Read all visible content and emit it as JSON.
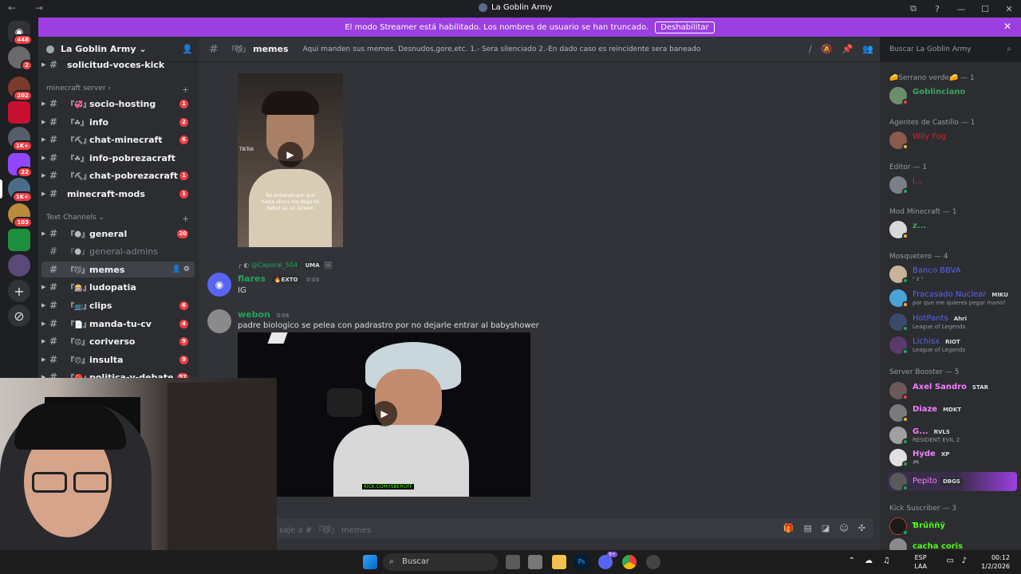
{
  "window": {
    "title": "La Goblin Army",
    "nav_arrows": "← →",
    "controls": [
      "⧉",
      "?",
      "—",
      "☐",
      "✕"
    ]
  },
  "banner": {
    "text": "El modo Streamer está habilitado. Los nombres de usuario se han truncado.",
    "button": "Deshabilitar",
    "close": "✕"
  },
  "rail": {
    "badges": [
      "448",
      "2",
      "202",
      "1K+",
      "22",
      "1K+",
      "103"
    ]
  },
  "guild": {
    "name": "La Goblin Army",
    "chevron": "⌄",
    "channels_top": [
      {
        "name": "solicitud-voces-kick",
        "emoji": "",
        "count": ""
      }
    ],
    "cat_minecraft": "minecraft server ›",
    "channels_mc": [
      {
        "name": "socio-hosting",
        "emoji": "『💞』",
        "count": "1"
      },
      {
        "name": "info",
        "emoji": "『☘』",
        "count": "2"
      },
      {
        "name": "chat-minecraft",
        "emoji": "『⛏』",
        "count": "6"
      },
      {
        "name": "info-pobrezacraft",
        "emoji": "『☘』",
        "count": ""
      },
      {
        "name": "chat-pobrezacraft",
        "emoji": "『⛏』",
        "count": "1"
      },
      {
        "name": "minecraft-mods",
        "emoji": "",
        "count": "1"
      }
    ],
    "cat_text": "Text Channels ⌄",
    "channels_text": [
      {
        "name": "general",
        "emoji": "『🌑』",
        "count": "20"
      },
      {
        "name": "general-admins",
        "emoji": "『🌑』",
        "count": ""
      },
      {
        "name": "memes",
        "emoji": "『😼』",
        "count": ""
      },
      {
        "name": "ludopatia",
        "emoji": "『🎰』",
        "count": ""
      },
      {
        "name": "clips",
        "emoji": "『📺』",
        "count": "6"
      },
      {
        "name": "manda-tu-cv",
        "emoji": "『📄』",
        "count": "4"
      },
      {
        "name": "coriverso",
        "emoji": "『😡』",
        "count": "9"
      },
      {
        "name": "insulta",
        "emoji": "『😠』",
        "count": "9"
      },
      {
        "name": "politica-y-debate",
        "emoji": "『🔴』",
        "count": "57"
      }
    ]
  },
  "channel": {
    "name": "memes",
    "emoji": "『😼』",
    "topic": "Aqui manden sus memes. Desnudos,gore,etc. 1.- Sera silenciado 2.-En dado caso es reincidente sera baneado",
    "search_placeholder": "Buscar La Goblin Army"
  },
  "messages": [
    {
      "reply_to": "@Caporal_504",
      "reply_tag": "UMA",
      "author": "flares",
      "tag": "🔥EXTO",
      "time": "0:03",
      "text": "IG",
      "color": "#23a55a"
    },
    {
      "author": "webon",
      "time": "0:04",
      "text": "padre biologico se pelea con padrastro por no dejarle entrar al babyshower",
      "color": "#23a55a"
    }
  ],
  "video1": {
    "caption": "No entiendo por qué hasta ahora me llega mi debut en un stream",
    "brand": "TikTok"
  },
  "video2": {
    "caption": "KICK.COM/ISBEROFF"
  },
  "composer": {
    "placeholder": "saje a # 『😼』 memes"
  },
  "roles": [
    {
      "name": "🧀Serrano verde🧀 — 1",
      "members": [
        {
          "name": "Goblinciano",
          "color": "#3ba55c",
          "status": "#f23f43",
          "sub": ""
        }
      ]
    },
    {
      "name": "Agentes de Castillo — 1",
      "members": [
        {
          "name": "Wily Fog",
          "color": "#e11e1e",
          "status": "#f0b232",
          "sub": ""
        }
      ]
    },
    {
      "name": "Editor — 1",
      "members": [
        {
          "name": "i...",
          "color": "#e03b3b",
          "status": "#23a55a",
          "sub": ""
        }
      ]
    },
    {
      "name": "Mod Minecraft — 1",
      "members": [
        {
          "name": "z...",
          "color": "#3ba55c",
          "status": "#f0b232",
          "sub": ""
        }
      ]
    },
    {
      "name": "Mosquetero — 4",
      "members": [
        {
          "name": "Banco BBVA",
          "color": "#5865f2",
          "status": "#23a55a",
          "sub": "ᶻ z ᶻ"
        },
        {
          "name": "Fracasado Nuclear",
          "color": "#5865f2",
          "status": "#f0b232",
          "sub": "por que me quieres pegar mano?",
          "tag": "MIKU"
        },
        {
          "name": "HotPants",
          "color": "#5865f2",
          "status": "#23a55a",
          "sub": "League of Legends",
          "tag": "Ahri"
        },
        {
          "name": "Lichisx",
          "color": "#5865f2",
          "status": "#23a55a",
          "sub": "League of Legends",
          "tag": "RIOT"
        }
      ]
    },
    {
      "name": "Server Booster — 5",
      "members": [
        {
          "name": "Axel Sandro",
          "color": "#f47fff",
          "status": "#f23f43",
          "sub": "",
          "tag": "STAR"
        },
        {
          "name": "Diaze",
          "color": "#f47fff",
          "status": "#f0b232",
          "sub": "",
          "tag": "MDKT"
        },
        {
          "name": "G...",
          "color": "#f47fff",
          "status": "#23a55a",
          "sub": "RESIDENT EVIL 2",
          "tag": "RVLS"
        },
        {
          "name": "Hyde",
          "color": "#f47fff",
          "status": "#23a55a",
          "sub": "🎮",
          "tag": "XP"
        },
        {
          "name": "Pepito",
          "color": "#f47fff",
          "status": "#23a55a",
          "sub": "",
          "tag": "DBGS"
        }
      ]
    },
    {
      "name": "Kick Suscriber — 3",
      "members": [
        {
          "name": "Ɓrűññỹ",
          "color": "#53fc18",
          "status": "#23a55a",
          "sub": ""
        },
        {
          "name": "cacha coris",
          "color": "#53fc18",
          "status": "#23a55a",
          "sub": ""
        }
      ]
    }
  ],
  "taskbar": {
    "search": "Buscar",
    "lang": "ESP",
    "layout": "LAA",
    "time": "00:12",
    "date": "1/2/2026",
    "discord_badge": "9+"
  }
}
